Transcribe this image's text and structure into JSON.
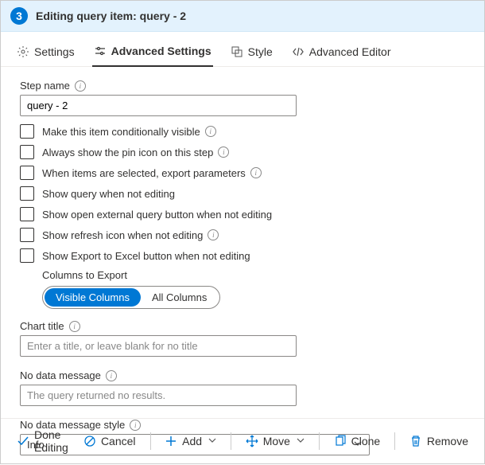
{
  "header": {
    "step_number": "3",
    "title": "Editing query item: query - 2"
  },
  "tabs": {
    "settings": "Settings",
    "advanced": "Advanced Settings",
    "style": "Style",
    "editor": "Advanced Editor"
  },
  "fields": {
    "step_name_label": "Step name",
    "step_name_value": "query - 2",
    "chart_title_label": "Chart title",
    "chart_title_placeholder": "Enter a title, or leave blank for no title",
    "no_data_label": "No data message",
    "no_data_placeholder": "The query returned no results.",
    "no_data_style_label": "No data message style",
    "no_data_style_value": "Info"
  },
  "checkboxes": {
    "cond_visible": "Make this item conditionally visible",
    "pin_icon": "Always show the pin icon on this step",
    "export_params": "When items are selected, export parameters",
    "show_query": "Show query when not editing",
    "show_external": "Show open external query button when not editing",
    "show_refresh": "Show refresh icon when not editing",
    "show_export": "Show Export to Excel button when not editing"
  },
  "columns_export": {
    "label": "Columns to Export",
    "visible": "Visible Columns",
    "all": "All Columns"
  },
  "footer": {
    "done": "Done Editing",
    "cancel": "Cancel",
    "add": "Add",
    "move": "Move",
    "clone": "Clone",
    "remove": "Remove"
  }
}
